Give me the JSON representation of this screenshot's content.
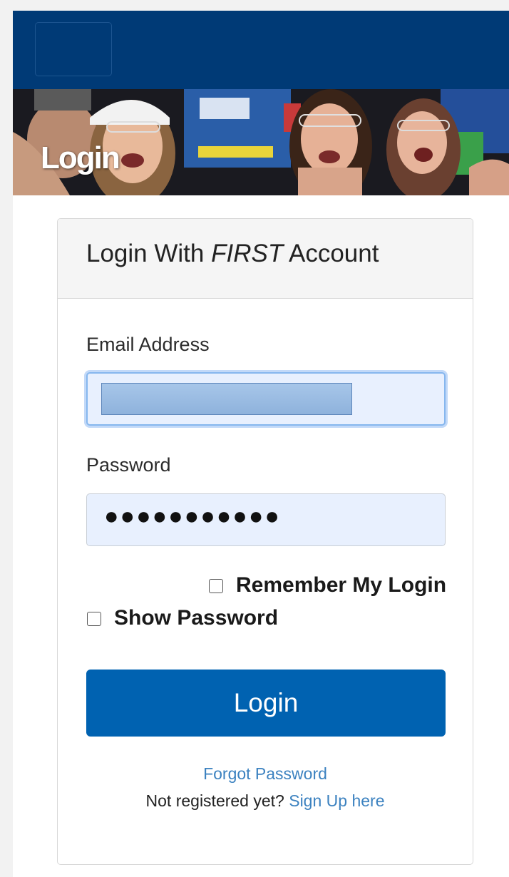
{
  "hero": {
    "title": "Login"
  },
  "panel": {
    "title_prefix": "Login With ",
    "title_brand": "FIRST",
    "title_suffix": " Account"
  },
  "form": {
    "email_label": "Email Address",
    "password_label": "Password",
    "password_masked": "●●●●●●●●●●●",
    "remember_label": "Remember My Login",
    "show_password_label": "Show Password",
    "login_button": "Login"
  },
  "links": {
    "forgot_password": "Forgot Password",
    "not_registered": "Not registered yet?",
    "sign_up": "Sign Up here"
  },
  "colors": {
    "navbar": "#003a76",
    "primary_button": "#0062b1",
    "link": "#3c82c0",
    "input_autofill": "#e8f0fe"
  }
}
